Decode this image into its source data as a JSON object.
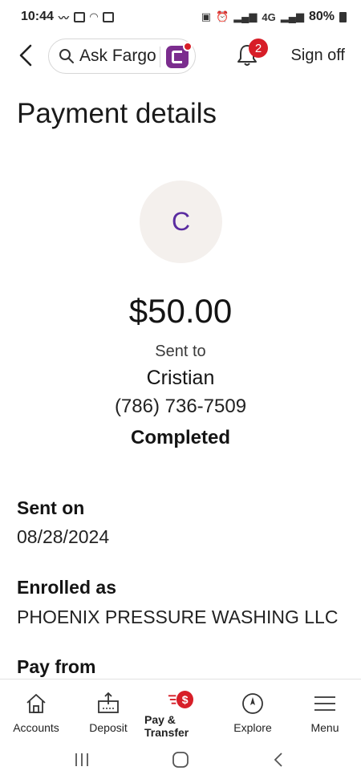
{
  "status_bar": {
    "time": "10:44",
    "network": "4G",
    "battery": "80%"
  },
  "top_nav": {
    "ask_label": "Ask Fargo",
    "notification_count": "2",
    "sign_off_label": "Sign off"
  },
  "page": {
    "title": "Payment details"
  },
  "payment": {
    "avatar_initial": "C",
    "amount": "$50.00",
    "sent_to_label": "Sent to",
    "recipient_name": "Cristian",
    "recipient_phone": "(786) 736-7509",
    "status": "Completed"
  },
  "details": [
    {
      "label": "Sent on",
      "value": "08/28/2024"
    },
    {
      "label": "Enrolled as",
      "value": "PHOENIX PRESSURE WASHING LLC"
    },
    {
      "label": "Pay from",
      "value": ""
    }
  ],
  "bottom_nav": {
    "items": [
      {
        "label": "Accounts",
        "icon": "home-icon"
      },
      {
        "label": "Deposit",
        "icon": "deposit-icon"
      },
      {
        "label": "Pay & Transfer",
        "icon": "pay-transfer-icon",
        "active": true
      },
      {
        "label": "Explore",
        "icon": "compass-icon"
      },
      {
        "label": "Menu",
        "icon": "hamburger-icon"
      }
    ]
  },
  "colors": {
    "brand_red": "#d71e28",
    "fargo_purple": "#7b2d8e",
    "avatar_bg": "#f4f0ed",
    "avatar_text": "#5a2ca0"
  }
}
